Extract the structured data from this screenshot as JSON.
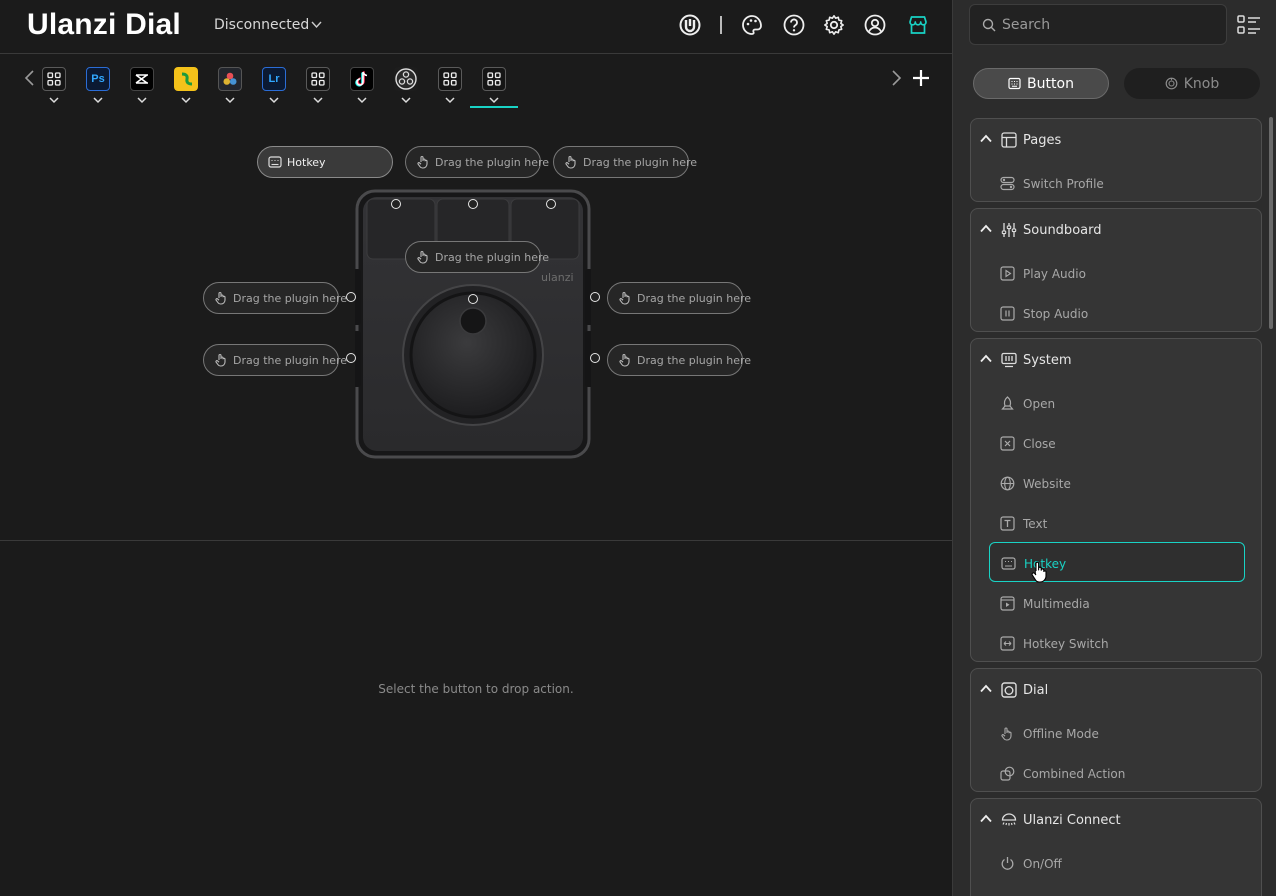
{
  "app": {
    "title": "Ulanzi Dial",
    "connection_status": "Disconnected"
  },
  "header_icons": [
    "ulanzi-logo-icon",
    "palette-icon",
    "help-icon",
    "settings-icon",
    "account-icon",
    "store-icon"
  ],
  "profiles": [
    {
      "kind": "grid",
      "label": ""
    },
    {
      "kind": "ps",
      "label": "Ps"
    },
    {
      "kind": "capcut",
      "label": ""
    },
    {
      "kind": "app",
      "label": ""
    },
    {
      "kind": "resolve",
      "label": ""
    },
    {
      "kind": "lr",
      "label": "Lr"
    },
    {
      "kind": "grid",
      "label": ""
    },
    {
      "kind": "tiktok",
      "label": ""
    },
    {
      "kind": "obs",
      "label": ""
    },
    {
      "kind": "grid",
      "label": ""
    },
    {
      "kind": "grid",
      "label": "",
      "active": true
    }
  ],
  "slots": {
    "top_1": "Hotkey",
    "top_2": "Drag the plugin here",
    "top_3": "Drag the plugin here",
    "center": "Drag the plugin here",
    "left_1": "Drag the plugin here",
    "left_2": "Drag the plugin here",
    "right_1": "Drag the plugin here",
    "right_2": "Drag the plugin here"
  },
  "device": {
    "brand": "ulanzi"
  },
  "hint": "Select the button to drop action.",
  "sidebar": {
    "search_placeholder": "Search",
    "tabs": {
      "button": "Button",
      "knob": "Knob"
    },
    "groups": [
      {
        "title": "Pages",
        "items": [
          "Switch Profile"
        ]
      },
      {
        "title": "Soundboard",
        "items": [
          "Play Audio",
          "Stop Audio"
        ]
      },
      {
        "title": "System",
        "items": [
          "Open",
          "Close",
          "Website",
          "Text",
          "Hotkey",
          "Multimedia",
          "Hotkey Switch"
        ],
        "selected": "Hotkey"
      },
      {
        "title": "Dial",
        "items": [
          "Offline Mode",
          "Combined Action"
        ]
      },
      {
        "title": "Ulanzi Connect",
        "items": [
          "On/Off"
        ]
      }
    ]
  },
  "colors": {
    "accent": "#19d3c5",
    "background": "#1b1b1b",
    "panel": "#2c2c2c"
  }
}
